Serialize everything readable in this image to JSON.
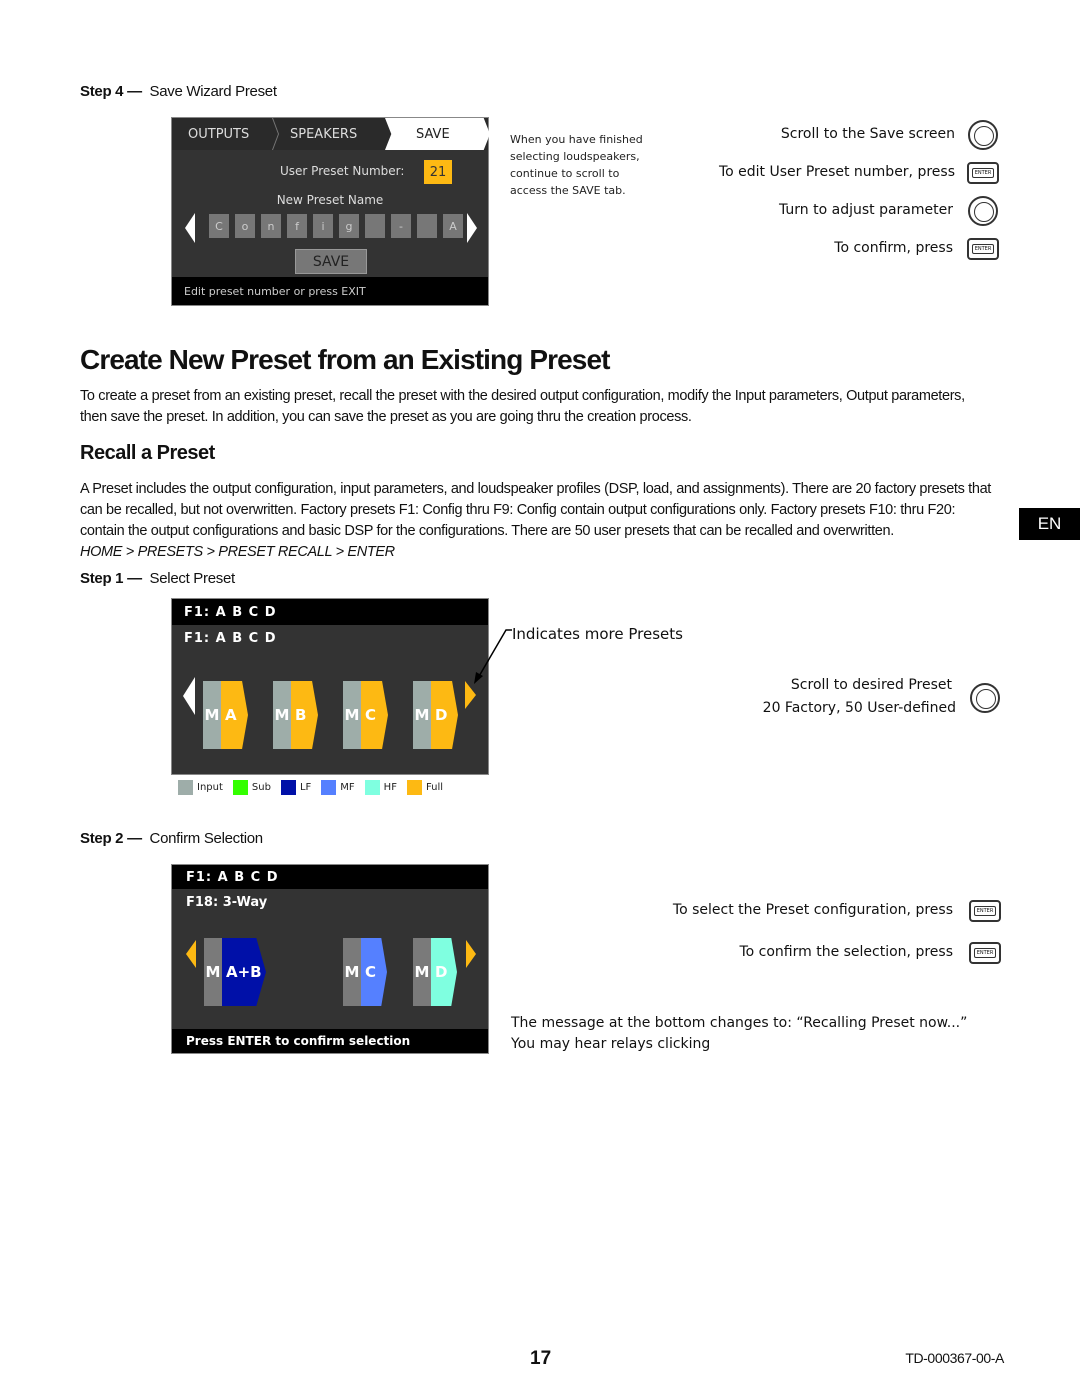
{
  "step4": {
    "step_label": "Step 4 —",
    "title": "Save Wizard Preset",
    "screen": {
      "tabs": [
        "OUTPUTS",
        "SPEAKERS",
        "SAVE"
      ],
      "preset_number_label": "User Preset Number:",
      "preset_number": "21",
      "name_label": "New Preset Name",
      "name_chars": [
        "C",
        "o",
        "n",
        "f",
        "i",
        "g",
        "",
        "-",
        "",
        "A"
      ],
      "save_button": "SAVE",
      "status": "Edit preset number or press EXIT"
    },
    "note": [
      "When you have finished",
      "selecting loudspeakers,",
      "continue to scroll to",
      "access the SAVE tab."
    ],
    "instructions": [
      {
        "text": "Scroll to the Save screen",
        "icon": "knob-icon"
      },
      {
        "text": "To edit User Preset number, press",
        "icon": "enter-button-icon"
      },
      {
        "text": "Turn to adjust parameter",
        "icon": "knob-icon"
      },
      {
        "text": "To confirm, press",
        "icon": "enter-button-icon"
      }
    ]
  },
  "section": {
    "title": "Create New Preset from an Existing Preset",
    "intro": "To create a preset from an existing preset, recall the preset with the desired output configuration, modify the Input parameters, Output parameters, then save the preset. In addition, you can save the preset as you are going thru the creation process."
  },
  "recall": {
    "title": "Recall a Preset",
    "body": "A Preset includes the output configuration, input parameters, and loudspeaker profiles (DSP, load, and assignments). There are 20 factory presets that can be recalled, but not overwritten. Factory presets F1: Config thru F9: Config contain output configurations only. Factory presets F10: thru F20: contain the output configurations and basic DSP for the configurations. There are 50 user presets that can be recalled and overwritten.",
    "path": "HOME > PRESETS > PRESET RECALL > ENTER",
    "lang_tab": "EN"
  },
  "step1": {
    "step_label": "Step 1 —",
    "title": "Select Preset",
    "screen": {
      "header": "F1:  A B C D",
      "current": "F1:  A B C D",
      "outputs": [
        {
          "m": "M",
          "label": "A",
          "color": "#FDB913"
        },
        {
          "m": "M",
          "label": "B",
          "color": "#FDB913"
        },
        {
          "m": "M",
          "label": "C",
          "color": "#FDB913"
        },
        {
          "m": "M",
          "label": "D",
          "color": "#FDB913"
        }
      ]
    },
    "legend": [
      {
        "label": "Input",
        "color": "#9EADA9"
      },
      {
        "label": "Sub",
        "color": "#33FF00"
      },
      {
        "label": "LF",
        "color": "#0010A8"
      },
      {
        "label": "MF",
        "color": "#5580FF"
      },
      {
        "label": "HF",
        "color": "#7FFFE0"
      },
      {
        "label": "Full",
        "color": "#FDB913"
      }
    ],
    "callout": "Indicates more Presets",
    "instructions": [
      "Scroll to desired Preset",
      "20 Factory, 50 User-defined"
    ]
  },
  "step2": {
    "step_label": "Step 2 —",
    "title": "Confirm Selection",
    "screen": {
      "header": "F1:  A B C D",
      "current": "F18: 3-Way",
      "outputs": [
        {
          "m": "M",
          "label": "A+B",
          "color": "#0010A8"
        },
        {
          "m": "M",
          "label": "C",
          "color": "#5580FF"
        },
        {
          "m": "M",
          "label": "D",
          "color": "#7FFFE0"
        }
      ],
      "status": "Press ENTER to confirm selection"
    },
    "instructions": [
      {
        "text": "To select the Preset configuration, press",
        "icon": "enter-button-icon"
      },
      {
        "text": "To confirm the selection, press",
        "icon": "enter-button-icon"
      }
    ],
    "message": [
      "The message at the bottom changes to:  “Recalling Preset now...”",
      "You may hear relays clicking"
    ]
  },
  "footer": {
    "page_number": "17",
    "doc_id": "TD-000367-00-A"
  }
}
